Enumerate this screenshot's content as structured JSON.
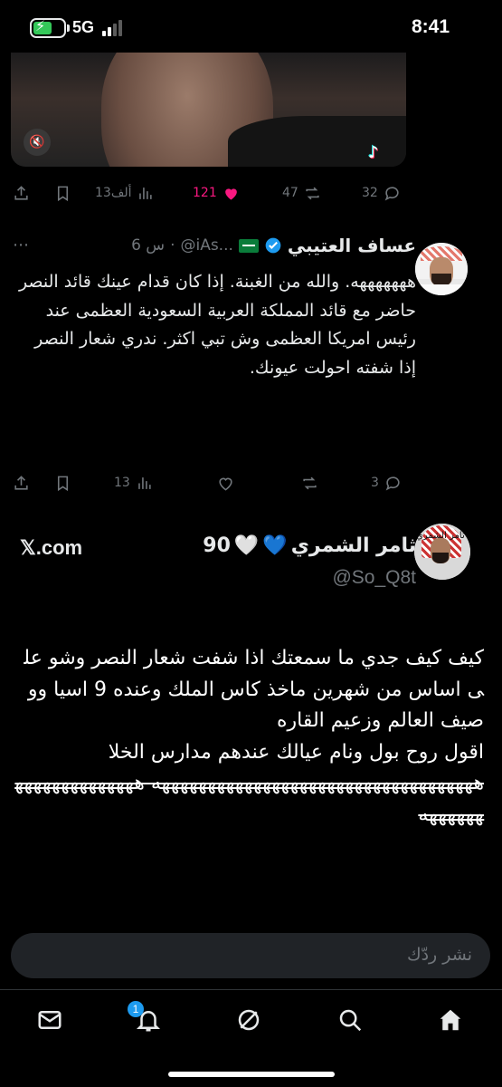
{
  "status_bar": {
    "time": "8:41",
    "network": "5G"
  },
  "media_actions": {
    "replies": "32",
    "reposts": "47",
    "likes": "121",
    "views": "13ألف"
  },
  "tweet1": {
    "display_name": "عساف العتيبي",
    "handle": "@iAs...",
    "time": "6 س",
    "text": "هههههههه. والله من الغبنة. إذا كان قدام عينك قائد النصر حاضر مع  قائد المملكة العربية السعودية العظمى عند رئيس امريكا العظمى  وش تبي اكثر. ندري شعار النصر إذا شفته احولت عيونك.",
    "replies": "3",
    "views": "13"
  },
  "tweet2": {
    "display_name": "ثامر الشمري",
    "name_suffix": "90",
    "handle": "@So_Q8t",
    "source": "𝕏.com",
    "avatar_text": "ثامر الشمري",
    "text_main": "كيف كيف جدي ما سمعتك اذا شفت شعار النصر وشو على اساس من شهرين ماخذ كاس الملك وعنده 9 اسيا ووصيف العالم وزعيم القاره\nاقول روح بول ونام عيالك عندهم مدارس الخلا",
    "text_laugh": "هههههههههههههههههههههههههههههههههههه ههههههههههههههههههههه"
  },
  "reply_bar": {
    "placeholder": "نشر ردّك"
  },
  "tabbar": {
    "notifications_badge": "1"
  },
  "colors": {
    "accent": "#1d9bf0",
    "like": "#f91880",
    "muted": "#71767b"
  }
}
